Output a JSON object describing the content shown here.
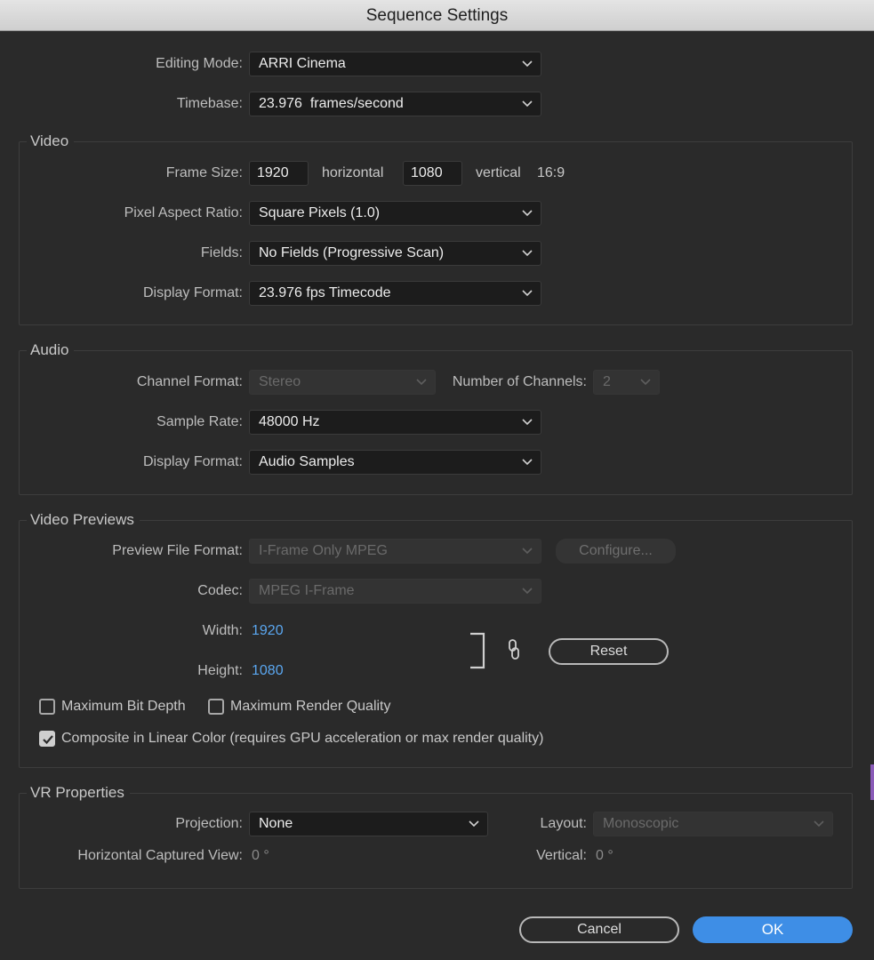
{
  "window": {
    "title": "Sequence Settings"
  },
  "general": {
    "editing_mode_label": "Editing Mode:",
    "editing_mode_value": "ARRI Cinema",
    "timebase_label": "Timebase:",
    "timebase_value": "23.976  frames/second"
  },
  "video": {
    "title": "Video",
    "frame_size_label": "Frame Size:",
    "frame_width": "1920",
    "horizontal_label": "horizontal",
    "frame_height": "1080",
    "vertical_label": "vertical",
    "aspect": "16:9",
    "pixel_aspect_label": "Pixel Aspect Ratio:",
    "pixel_aspect_value": "Square Pixels (1.0)",
    "fields_label": "Fields:",
    "fields_value": "No Fields (Progressive Scan)",
    "display_format_label": "Display Format:",
    "display_format_value": "23.976 fps Timecode"
  },
  "audio": {
    "title": "Audio",
    "channel_format_label": "Channel Format:",
    "channel_format_value": "Stereo",
    "num_channels_label": "Number of Channels:",
    "num_channels_value": "2",
    "sample_rate_label": "Sample Rate:",
    "sample_rate_value": "48000 Hz",
    "display_format_label": "Display Format:",
    "display_format_value": "Audio Samples"
  },
  "previews": {
    "title": "Video Previews",
    "file_format_label": "Preview File Format:",
    "file_format_value": "I-Frame Only MPEG",
    "configure_label": "Configure...",
    "codec_label": "Codec:",
    "codec_value": "MPEG I-Frame",
    "width_label": "Width:",
    "width_value": "1920",
    "height_label": "Height:",
    "height_value": "1080",
    "link_icon": "chain-link-icon",
    "reset_label": "Reset",
    "max_bit_depth_label": "Maximum Bit Depth",
    "max_bit_depth_checked": false,
    "max_render_label": "Maximum Render Quality",
    "max_render_checked": false,
    "linear_color_label": "Composite in Linear Color (requires GPU acceleration or max render quality)",
    "linear_color_checked": true
  },
  "vr": {
    "title": "VR Properties",
    "projection_label": "Projection:",
    "projection_value": "None",
    "layout_label": "Layout:",
    "layout_value": "Monoscopic",
    "h_view_label": "Horizontal Captured View:",
    "h_view_value": "0 °",
    "vertical_label": "Vertical:",
    "vertical_value": "0 °"
  },
  "buttons": {
    "cancel": "Cancel",
    "ok": "OK"
  },
  "colors": {
    "accent": "#3e8ee6",
    "link_value": "#5aa6ef",
    "background": "#2a2a2a"
  }
}
